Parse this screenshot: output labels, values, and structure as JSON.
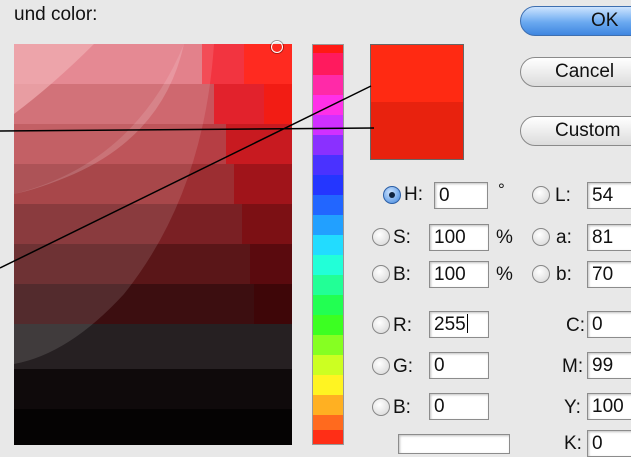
{
  "dialog": {
    "title": "und color:"
  },
  "buttons": {
    "ok": "OK",
    "cancel": "Cancel",
    "custom": "Custom"
  },
  "swatch": {
    "new_color": "#ff2a12",
    "current_color": "#e8220e"
  },
  "fields": {
    "h": {
      "label": "H:",
      "value": "0",
      "unit": "°",
      "selected": true
    },
    "s": {
      "label": "S:",
      "value": "100",
      "unit": "%"
    },
    "b": {
      "label": "B:",
      "value": "100",
      "unit": "%"
    },
    "r": {
      "label": "R:",
      "value": "255"
    },
    "g": {
      "label": "G:",
      "value": "0"
    },
    "b2": {
      "label": "B:",
      "value": "0"
    },
    "lab_l": {
      "label": "L:",
      "value": "54"
    },
    "lab_a": {
      "label": "a:",
      "value": "81"
    },
    "lab_b": {
      "label": "b:",
      "value": "70"
    },
    "c": {
      "label": "C:",
      "value": "0"
    },
    "m": {
      "label": "M:",
      "value": "99"
    },
    "y": {
      "label": "Y:",
      "value": "100"
    },
    "k": {
      "label": "K:",
      "value": "0"
    }
  }
}
